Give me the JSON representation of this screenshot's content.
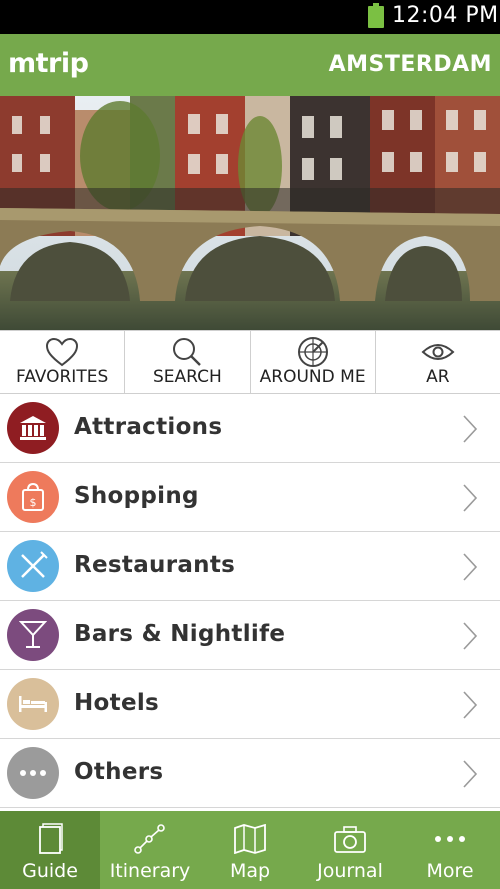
{
  "status_bar": {
    "time": "12:04 PM"
  },
  "header": {
    "logo": "mtrip",
    "city": "AMSTERDAM"
  },
  "quick_actions": [
    {
      "label": "FAVORITES",
      "icon": "heart-icon"
    },
    {
      "label": "SEARCH",
      "icon": "search-icon"
    },
    {
      "label": "AROUND ME",
      "icon": "radar-icon"
    },
    {
      "label": "AR",
      "icon": "eye-icon"
    }
  ],
  "categories": [
    {
      "label": "Attractions",
      "icon": "museum-icon",
      "color": "#8f1d22"
    },
    {
      "label": "Shopping",
      "icon": "shopping-bag-icon",
      "color": "#ee7a5c"
    },
    {
      "label": "Restaurants",
      "icon": "cutlery-icon",
      "color": "#5fb2e3"
    },
    {
      "label": "Bars & Nightlife",
      "icon": "cocktail-icon",
      "color": "#7c4b7e"
    },
    {
      "label": "Hotels",
      "icon": "bed-icon",
      "color": "#d9bf9a"
    },
    {
      "label": "Others",
      "icon": "more-dots-icon",
      "color": "#9b9b9b"
    }
  ],
  "tabs": [
    {
      "label": "Guide",
      "icon": "book-icon",
      "active": true
    },
    {
      "label": "Itinerary",
      "icon": "route-icon",
      "active": false
    },
    {
      "label": "Map",
      "icon": "map-icon",
      "active": false
    },
    {
      "label": "Journal",
      "icon": "camera-icon",
      "active": false
    },
    {
      "label": "More",
      "icon": "more-dots-icon",
      "active": false
    }
  ],
  "colors": {
    "brand_green": "#76a94c",
    "active_tab": "#5d8a37"
  }
}
